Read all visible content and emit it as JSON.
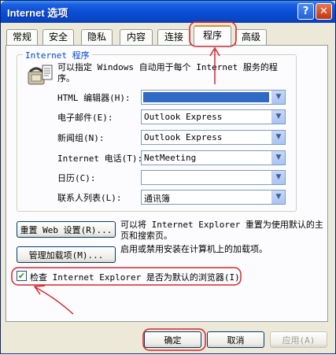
{
  "window": {
    "title": "Internet 选项",
    "help_glyph": "?",
    "close_glyph": "✕"
  },
  "tabs": [
    {
      "label": "常规"
    },
    {
      "label": "安全"
    },
    {
      "label": "隐私"
    },
    {
      "label": "内容"
    },
    {
      "label": "连接"
    },
    {
      "label": "程序",
      "active": true
    },
    {
      "label": "高级"
    }
  ],
  "programs": {
    "group_title": "Internet 程序",
    "description": "可以指定 Windows 自动用于每个 Internet 服务的程序。",
    "rows": [
      {
        "label": "HTML 编辑器(H):",
        "value": ""
      },
      {
        "label": "电子邮件(E):",
        "value": "Outlook Express"
      },
      {
        "label": "新闻组(N):",
        "value": "Outlook Express"
      },
      {
        "label": "Internet 电话(T):",
        "value": "NetMeeting"
      },
      {
        "label": "日历(C):",
        "value": ""
      },
      {
        "label": "联系人列表(L):",
        "value": "通讯簿"
      }
    ]
  },
  "reset": {
    "button_label": "重置 Web 设置(R)...",
    "text": "可以将 Internet Explorer 重置为使用默认的主页和搜索页。"
  },
  "addons": {
    "button_label": "管理加载项(M)...",
    "text": "启用或禁用安装在计算机上的加载项。"
  },
  "default_check": {
    "checked": true,
    "check_glyph": "✔",
    "label": "检查 Internet Explorer 是否为默认的浏览器(I)"
  },
  "footer": {
    "ok_label": "确定",
    "cancel_label": "取消",
    "apply_label": "应用(A)"
  },
  "colors": {
    "annotation": "#d8262e",
    "titlebar": "#0a4fd6",
    "active_tab_accent": "#e68b2c"
  },
  "dropdown_glyph": "▼"
}
